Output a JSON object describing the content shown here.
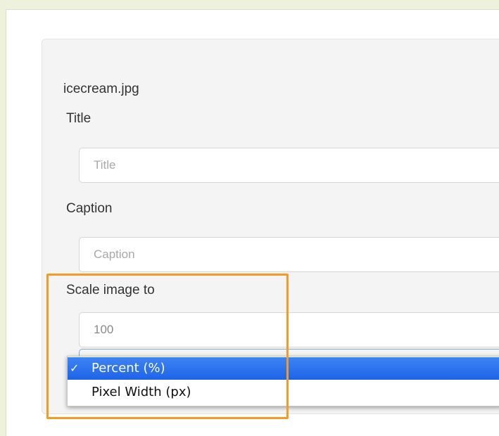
{
  "form": {
    "filename": "icecream.jpg",
    "title_label": "Title",
    "title_placeholder": "Title",
    "caption_label": "Caption",
    "caption_placeholder": "Caption",
    "scale_label": "Scale image to",
    "scale_value": "100"
  },
  "scale_unit_dropdown": {
    "options": [
      {
        "label": "Percent (%)",
        "selected": true
      },
      {
        "label": "Pixel Width (px)",
        "selected": false
      }
    ],
    "check_mark": "✓"
  },
  "colors": {
    "highlight": "#f59a23",
    "selected_option": "#2a6ff0",
    "background": "#eef2dc"
  }
}
